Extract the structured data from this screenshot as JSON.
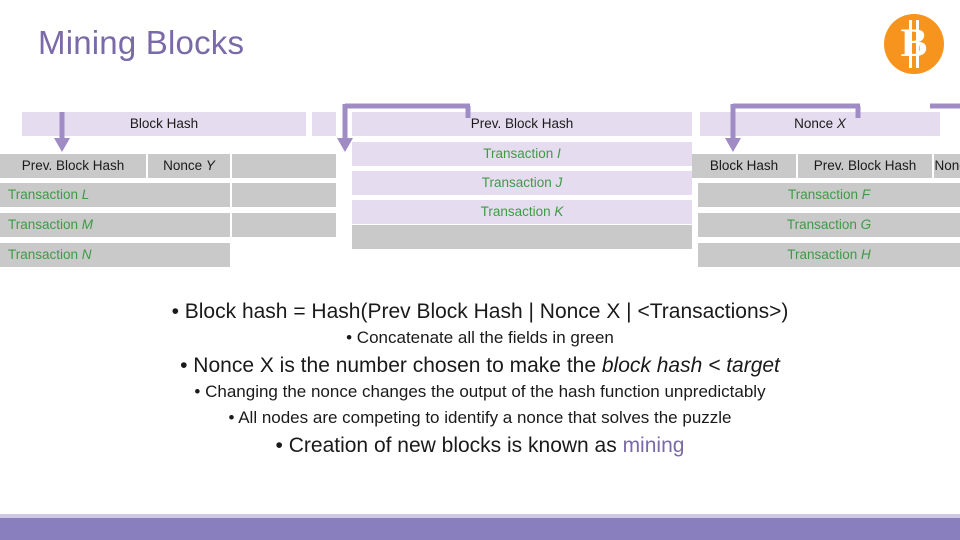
{
  "slide": {
    "title": "Mining Blocks",
    "logo_icon": "bitcoin-logo-icon",
    "logo_glyph": "B"
  },
  "diagram": {
    "blocks": [
      {
        "id": "block-left",
        "rows": [
          {
            "label": "Block Hash",
            "style": "purple-center"
          },
          {
            "label": "Prev. Block Hash",
            "style": "grey"
          },
          {
            "label": "Nonce Y",
            "style": "grey"
          },
          {
            "label": "Transaction L",
            "style": "green"
          },
          {
            "label": "Transaction M",
            "style": "green"
          },
          {
            "label": "Transaction N",
            "style": "green"
          }
        ]
      },
      {
        "id": "block-middle",
        "rows": [
          {
            "label": "Prev. Block Hash",
            "style": "purple-center"
          },
          {
            "label": "Transaction I",
            "style": "green"
          },
          {
            "label": "Transaction J",
            "style": "green"
          },
          {
            "label": "Transaction K",
            "style": "green"
          }
        ]
      },
      {
        "id": "block-right",
        "rows": [
          {
            "label": "Nonce X",
            "style": "purple-center"
          },
          {
            "label": "Block Hash",
            "style": "grey"
          },
          {
            "label": "Prev. Block Hash",
            "style": "grey"
          },
          {
            "label": "Nonce",
            "style": "grey-clipped"
          },
          {
            "label": "Transaction F",
            "style": "green"
          },
          {
            "label": "Transaction G",
            "style": "green"
          },
          {
            "label": "Transaction H",
            "style": "green"
          }
        ]
      }
    ]
  },
  "bullets": {
    "line1": "• Block hash = Hash(Prev Block Hash | Nonce X | <Transactions>)",
    "line2": "• Concatenate all the fields in green",
    "line3_pre": "• Nonce X is the number chosen to make the ",
    "line3_em": "block hash < target",
    "line4": "• Changing the nonce changes the output of the hash function unpredictably",
    "line5": "• All nodes are competing to identify a nonce that solves the puzzle",
    "line6_pre": "• Creation of new blocks is known as ",
    "line6_em": "mining"
  },
  "colors": {
    "accent": "#7a6aa8",
    "green": "#3f9a47",
    "grey": "#c9c9c9",
    "lavender": "#e6dcf0",
    "bitcoin_orange": "#f7941d",
    "footer": "#8a7fbe"
  }
}
